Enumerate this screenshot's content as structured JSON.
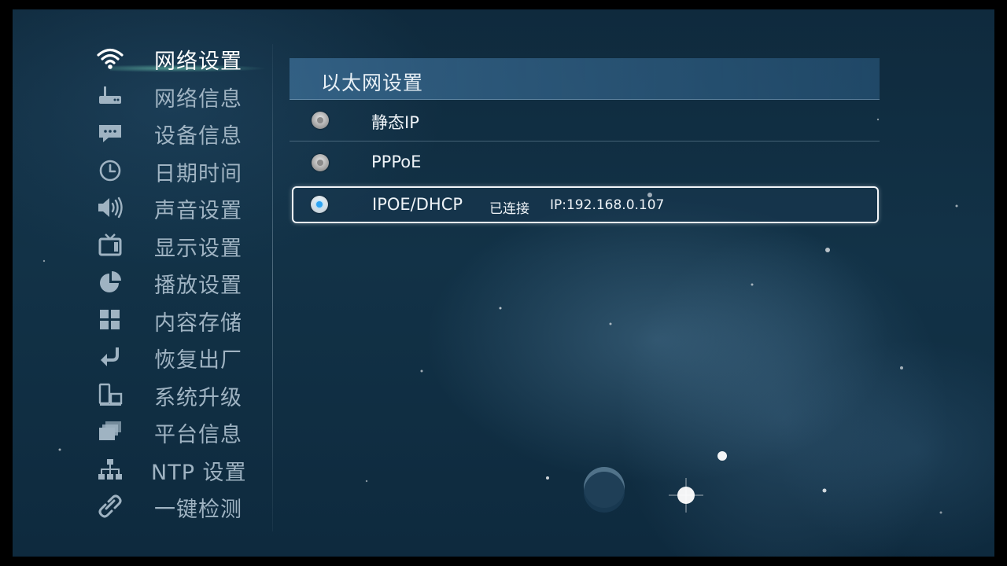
{
  "sidebar": {
    "items": [
      {
        "label": "网络设置",
        "icon": "wifi-icon",
        "active": true
      },
      {
        "label": "网络信息",
        "icon": "router-icon"
      },
      {
        "label": "设备信息",
        "icon": "chat-bubble-icon"
      },
      {
        "label": "日期时间",
        "icon": "clock-icon"
      },
      {
        "label": "声音设置",
        "icon": "speaker-icon"
      },
      {
        "label": "显示设置",
        "icon": "tv-icon"
      },
      {
        "label": "播放设置",
        "icon": "pie-chart-icon"
      },
      {
        "label": "内容存储",
        "icon": "grid-icon"
      },
      {
        "label": "恢复出厂",
        "icon": "return-arrow-icon"
      },
      {
        "label": "系统升级",
        "icon": "devices-icon"
      },
      {
        "label": "平台信息",
        "icon": "stacked-cards-icon"
      },
      {
        "label": "NTP 设置",
        "icon": "network-tree-icon"
      },
      {
        "label": "一键检测",
        "icon": "link-icon"
      }
    ]
  },
  "panel": {
    "title": "以太网设置",
    "options": [
      {
        "label": "静态IP",
        "checked": false
      },
      {
        "label": "PPPoE",
        "checked": false
      },
      {
        "label": "IPOE/DHCP",
        "checked": true,
        "status": "已连接",
        "ip": "IP:192.168.0.107"
      }
    ]
  },
  "colors": {
    "accent": "#2da3f2",
    "text": "#eef3f7",
    "muted": "#9fb3c2"
  }
}
